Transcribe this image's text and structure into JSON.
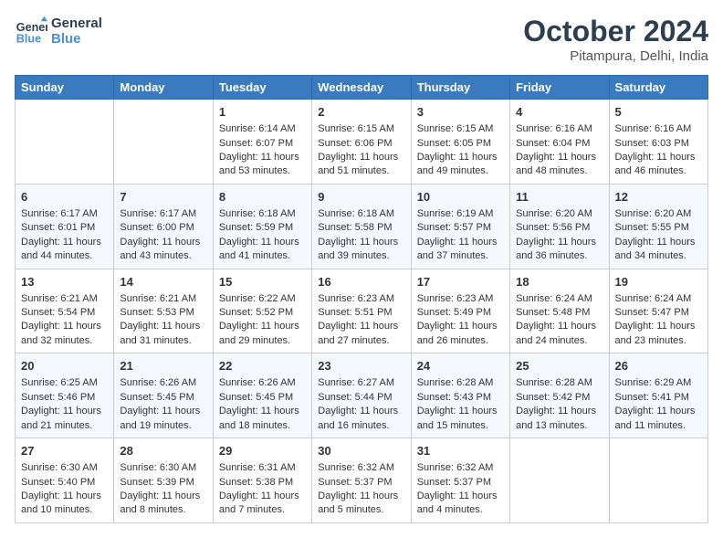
{
  "header": {
    "logo_line1": "General",
    "logo_line2": "Blue",
    "month": "October 2024",
    "location": "Pitampura, Delhi, India"
  },
  "weekdays": [
    "Sunday",
    "Monday",
    "Tuesday",
    "Wednesday",
    "Thursday",
    "Friday",
    "Saturday"
  ],
  "weeks": [
    [
      {
        "day": "",
        "info": ""
      },
      {
        "day": "",
        "info": ""
      },
      {
        "day": "1",
        "info": "Sunrise: 6:14 AM\nSunset: 6:07 PM\nDaylight: 11 hours and 53 minutes."
      },
      {
        "day": "2",
        "info": "Sunrise: 6:15 AM\nSunset: 6:06 PM\nDaylight: 11 hours and 51 minutes."
      },
      {
        "day": "3",
        "info": "Sunrise: 6:15 AM\nSunset: 6:05 PM\nDaylight: 11 hours and 49 minutes."
      },
      {
        "day": "4",
        "info": "Sunrise: 6:16 AM\nSunset: 6:04 PM\nDaylight: 11 hours and 48 minutes."
      },
      {
        "day": "5",
        "info": "Sunrise: 6:16 AM\nSunset: 6:03 PM\nDaylight: 11 hours and 46 minutes."
      }
    ],
    [
      {
        "day": "6",
        "info": "Sunrise: 6:17 AM\nSunset: 6:01 PM\nDaylight: 11 hours and 44 minutes."
      },
      {
        "day": "7",
        "info": "Sunrise: 6:17 AM\nSunset: 6:00 PM\nDaylight: 11 hours and 43 minutes."
      },
      {
        "day": "8",
        "info": "Sunrise: 6:18 AM\nSunset: 5:59 PM\nDaylight: 11 hours and 41 minutes."
      },
      {
        "day": "9",
        "info": "Sunrise: 6:18 AM\nSunset: 5:58 PM\nDaylight: 11 hours and 39 minutes."
      },
      {
        "day": "10",
        "info": "Sunrise: 6:19 AM\nSunset: 5:57 PM\nDaylight: 11 hours and 37 minutes."
      },
      {
        "day": "11",
        "info": "Sunrise: 6:20 AM\nSunset: 5:56 PM\nDaylight: 11 hours and 36 minutes."
      },
      {
        "day": "12",
        "info": "Sunrise: 6:20 AM\nSunset: 5:55 PM\nDaylight: 11 hours and 34 minutes."
      }
    ],
    [
      {
        "day": "13",
        "info": "Sunrise: 6:21 AM\nSunset: 5:54 PM\nDaylight: 11 hours and 32 minutes."
      },
      {
        "day": "14",
        "info": "Sunrise: 6:21 AM\nSunset: 5:53 PM\nDaylight: 11 hours and 31 minutes."
      },
      {
        "day": "15",
        "info": "Sunrise: 6:22 AM\nSunset: 5:52 PM\nDaylight: 11 hours and 29 minutes."
      },
      {
        "day": "16",
        "info": "Sunrise: 6:23 AM\nSunset: 5:51 PM\nDaylight: 11 hours and 27 minutes."
      },
      {
        "day": "17",
        "info": "Sunrise: 6:23 AM\nSunset: 5:49 PM\nDaylight: 11 hours and 26 minutes."
      },
      {
        "day": "18",
        "info": "Sunrise: 6:24 AM\nSunset: 5:48 PM\nDaylight: 11 hours and 24 minutes."
      },
      {
        "day": "19",
        "info": "Sunrise: 6:24 AM\nSunset: 5:47 PM\nDaylight: 11 hours and 23 minutes."
      }
    ],
    [
      {
        "day": "20",
        "info": "Sunrise: 6:25 AM\nSunset: 5:46 PM\nDaylight: 11 hours and 21 minutes."
      },
      {
        "day": "21",
        "info": "Sunrise: 6:26 AM\nSunset: 5:45 PM\nDaylight: 11 hours and 19 minutes."
      },
      {
        "day": "22",
        "info": "Sunrise: 6:26 AM\nSunset: 5:45 PM\nDaylight: 11 hours and 18 minutes."
      },
      {
        "day": "23",
        "info": "Sunrise: 6:27 AM\nSunset: 5:44 PM\nDaylight: 11 hours and 16 minutes."
      },
      {
        "day": "24",
        "info": "Sunrise: 6:28 AM\nSunset: 5:43 PM\nDaylight: 11 hours and 15 minutes."
      },
      {
        "day": "25",
        "info": "Sunrise: 6:28 AM\nSunset: 5:42 PM\nDaylight: 11 hours and 13 minutes."
      },
      {
        "day": "26",
        "info": "Sunrise: 6:29 AM\nSunset: 5:41 PM\nDaylight: 11 hours and 11 minutes."
      }
    ],
    [
      {
        "day": "27",
        "info": "Sunrise: 6:30 AM\nSunset: 5:40 PM\nDaylight: 11 hours and 10 minutes."
      },
      {
        "day": "28",
        "info": "Sunrise: 6:30 AM\nSunset: 5:39 PM\nDaylight: 11 hours and 8 minutes."
      },
      {
        "day": "29",
        "info": "Sunrise: 6:31 AM\nSunset: 5:38 PM\nDaylight: 11 hours and 7 minutes."
      },
      {
        "day": "30",
        "info": "Sunrise: 6:32 AM\nSunset: 5:37 PM\nDaylight: 11 hours and 5 minutes."
      },
      {
        "day": "31",
        "info": "Sunrise: 6:32 AM\nSunset: 5:37 PM\nDaylight: 11 hours and 4 minutes."
      },
      {
        "day": "",
        "info": ""
      },
      {
        "day": "",
        "info": ""
      }
    ]
  ]
}
